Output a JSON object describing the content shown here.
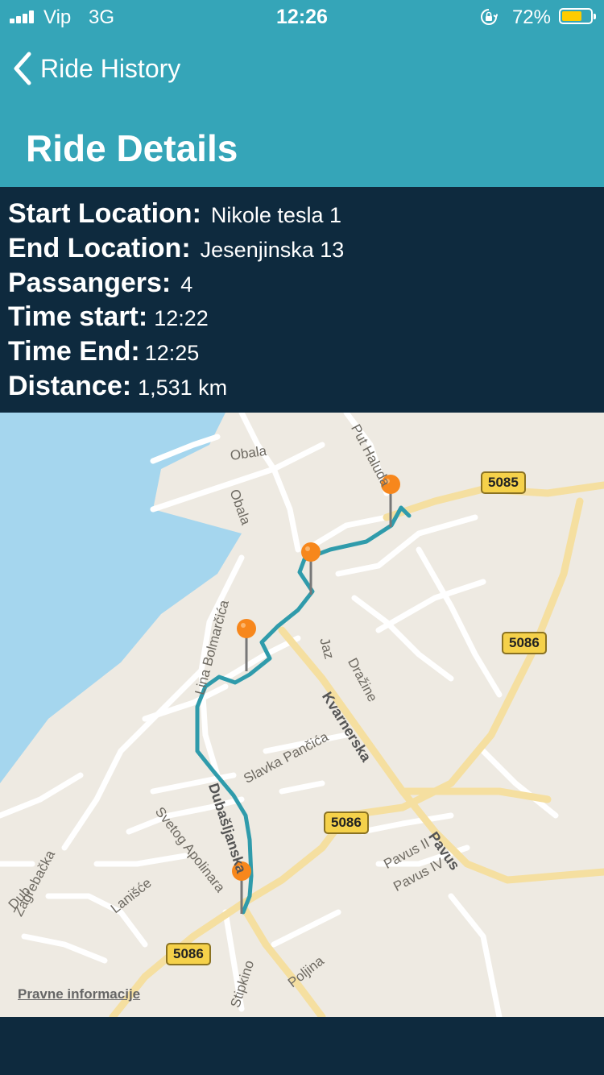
{
  "status_bar": {
    "carrier": "Vip",
    "network": "3G",
    "time": "12:26",
    "battery_percent": "72%",
    "battery_level": 0.72
  },
  "header": {
    "back_label": "Ride History",
    "title": "Ride Details"
  },
  "details": {
    "start_location": {
      "label": "Start Location:",
      "value": "Nikole tesla 1"
    },
    "end_location": {
      "label": "End Location:",
      "value": "Jesenjinska 13"
    },
    "passengers": {
      "label": "Passangers:",
      "value": "4"
    },
    "time_start": {
      "label": "Time start:",
      "value": "12:22"
    },
    "time_end": {
      "label": "Time End:",
      "value": "12:25"
    },
    "distance": {
      "label": "Distance:",
      "value": "1,531 km"
    }
  },
  "map": {
    "street_labels": {
      "obala_1": "Obala",
      "obala_2": "Obala",
      "put_haluda": "Put Haluda",
      "lina_bolmarcica": "Lina Bolmarčića",
      "jaz": "Jaz",
      "drazine": "Dražine",
      "kvarnerska": "Kvarnerska",
      "slavka_pancica": "Slavka Pančića",
      "dubasljanska": "Dubašljanska",
      "svetog_apolinara": "Svetog Apolinara",
      "pavus": "Pavus",
      "pavus_ii": "Pavus II",
      "pavus_iv": "Pavus IV",
      "dub": "Dub",
      "zagrebacka": "Zagrebačka",
      "laniste": "Lanišće",
      "stipkino": "Stipkino",
      "poljina": "Poljina"
    },
    "road_shields": {
      "r5085": "5085",
      "r5086_a": "5086",
      "r5086_b": "5086",
      "r5086_c": "5086"
    },
    "legal_link": "Pravne informacije",
    "route_color": "#2f9bab",
    "pin_color": "#f7871c",
    "water_color": "#a5d6ee"
  }
}
